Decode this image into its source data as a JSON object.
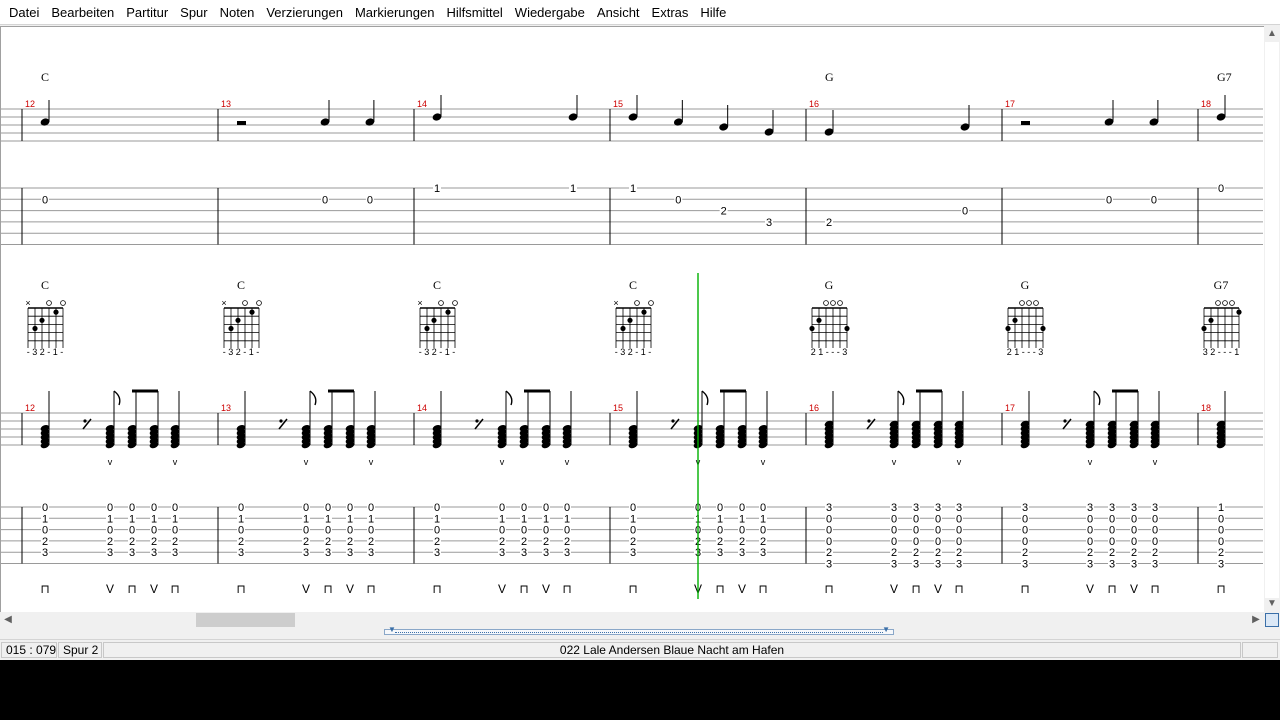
{
  "menu": [
    "Datei",
    "Bearbeiten",
    "Partitur",
    "Spur",
    "Noten",
    "Verzierungen",
    "Markierungen",
    "Hilfsmittel",
    "Wiedergabe",
    "Ansicht",
    "Extras",
    "Hilfe"
  ],
  "system1": {
    "measures": [
      {
        "number": "12",
        "chord": "C",
        "tab": [
          {
            "string": 2,
            "fret": "0"
          }
        ]
      },
      {
        "number": "13",
        "chord": "",
        "tab": [
          {
            "string": 2,
            "fret": "0"
          },
          {
            "string": 2,
            "fret": "0"
          }
        ]
      },
      {
        "number": "14",
        "chord": "",
        "tab": [
          {
            "string": 1,
            "fret": "1"
          },
          {
            "string": 1,
            "fret": "1"
          }
        ]
      },
      {
        "number": "15",
        "chord": "",
        "tab": [
          {
            "string": 1,
            "fret": "1"
          },
          {
            "string": 2,
            "fret": "0"
          },
          {
            "string": 3,
            "fret": "2"
          },
          {
            "string": 4,
            "fret": "3"
          }
        ]
      },
      {
        "number": "16",
        "chord": "G",
        "tab": [
          {
            "string": 4,
            "fret": "2"
          },
          {
            "string": 3,
            "fret": "0"
          }
        ]
      },
      {
        "number": "17",
        "chord": "",
        "tab": [
          {
            "string": 2,
            "fret": "0"
          },
          {
            "string": 2,
            "fret": "0"
          }
        ]
      },
      {
        "number": "18",
        "chord": "G7",
        "tab": [
          {
            "string": 1,
            "fret": "0"
          }
        ]
      }
    ]
  },
  "system2": {
    "measures": [
      {
        "number": "12",
        "chord": "C",
        "fingering": "- 3 2 - 1 -",
        "shape": "C"
      },
      {
        "number": "13",
        "chord": "C",
        "fingering": "- 3 2 - 1 -",
        "shape": "C"
      },
      {
        "number": "14",
        "chord": "C",
        "fingering": "- 3 2 - 1 -",
        "shape": "C"
      },
      {
        "number": "15",
        "chord": "C",
        "fingering": "- 3 2 - 1 -",
        "shape": "C"
      },
      {
        "number": "16",
        "chord": "G",
        "fingering": "2 1 - - - 3",
        "shape": "G"
      },
      {
        "number": "17",
        "chord": "G",
        "fingering": "2 1 - - - 3",
        "shape": "G"
      },
      {
        "number": "18",
        "chord": "G7",
        "fingering": "3 2 - - - 1",
        "shape": "G7"
      }
    ],
    "tab_columns": {
      "C_bass": [
        "0",
        "1",
        "0",
        "2",
        "3"
      ],
      "C_strum": [
        "0",
        "1",
        "0",
        "2",
        "3"
      ],
      "G_bass": [
        "3",
        "0",
        "0",
        "0",
        "2",
        "3"
      ],
      "G_strum": [
        "3",
        "0",
        "0",
        "0",
        "2",
        "3"
      ],
      "G7_bass": [
        "1",
        "0",
        "0",
        "0",
        "2",
        "3"
      ]
    },
    "pick_down": "⊓",
    "pick_up": "V"
  },
  "colors": {
    "measure_number": "#cc0000",
    "cursor": "#00b000"
  },
  "status": {
    "position": "015 : 079",
    "track": "Spur 2",
    "title": "022  Lale Andersen  Blaue Nacht am Hafen"
  }
}
